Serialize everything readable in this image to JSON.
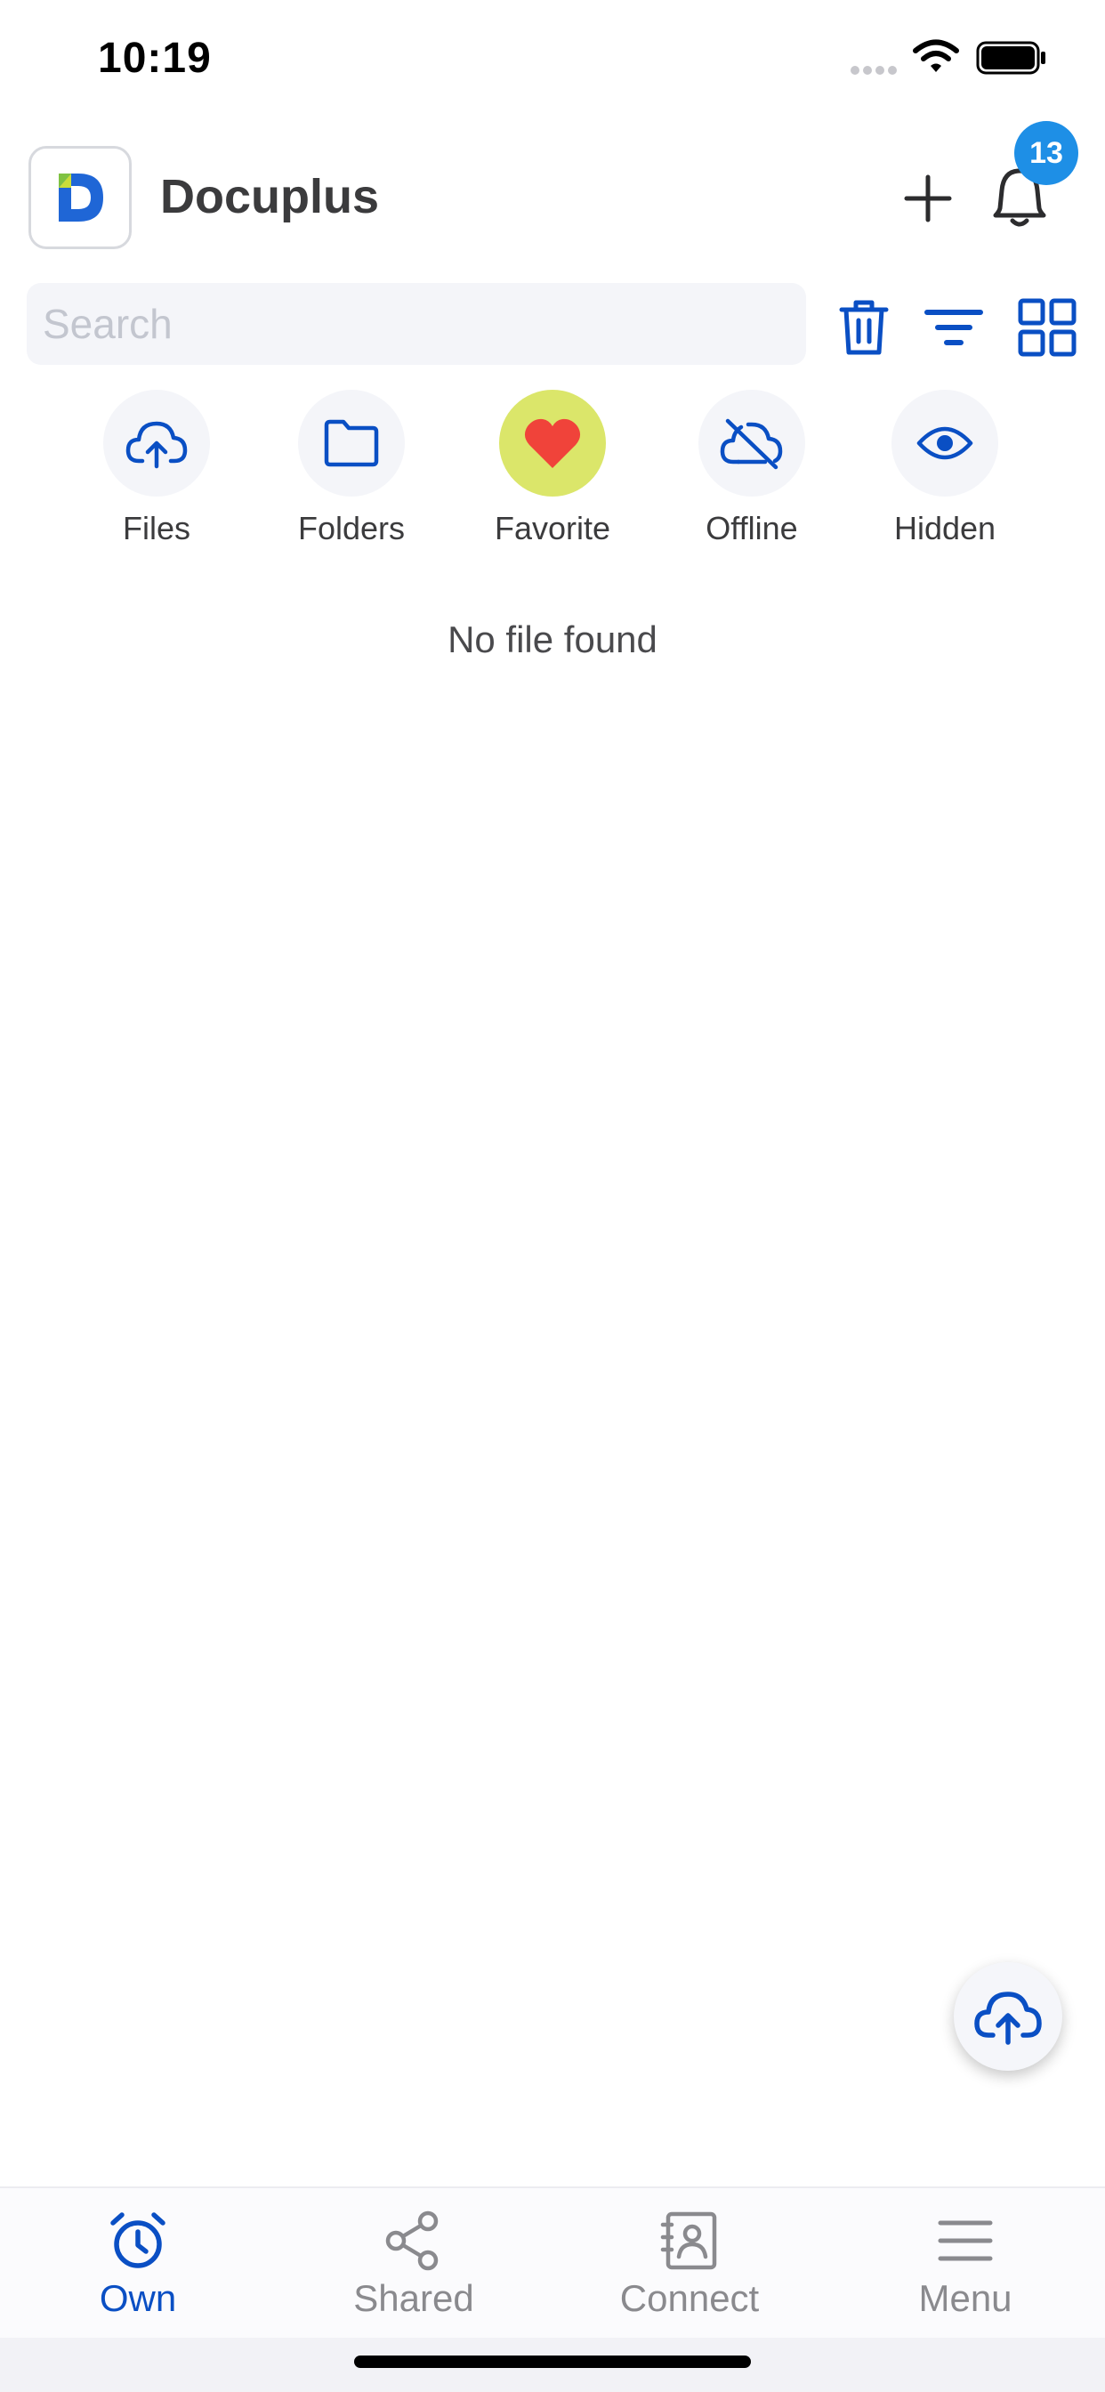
{
  "status_bar": {
    "time": "10:19"
  },
  "header": {
    "app_name": "Docuplus",
    "notification_count": "13"
  },
  "search": {
    "placeholder": "Search",
    "value": ""
  },
  "categories": [
    {
      "label": "Files",
      "icon": "cloud-upload-icon",
      "active": false
    },
    {
      "label": "Folders",
      "icon": "folder-icon",
      "active": false
    },
    {
      "label": "Favorite",
      "icon": "heart-icon",
      "active": true
    },
    {
      "label": "Offline",
      "icon": "cloud-off-icon",
      "active": false
    },
    {
      "label": "Hidden",
      "icon": "eye-icon",
      "active": false
    }
  ],
  "empty_state": {
    "message": "No file found"
  },
  "tab_bar": {
    "tabs": [
      {
        "label": "Own",
        "icon": "alarm-clock-icon",
        "active": true
      },
      {
        "label": "Shared",
        "icon": "share-icon",
        "active": false
      },
      {
        "label": "Connect",
        "icon": "contacts-icon",
        "active": false
      },
      {
        "label": "Menu",
        "icon": "hamburger-menu-icon",
        "active": false
      }
    ]
  },
  "colors": {
    "accent": "#0a4fc4",
    "badge": "#1e8fe6",
    "favorite_highlight": "#dbe66a",
    "heart": "#f0433a",
    "inactive": "#8a8a8e"
  }
}
